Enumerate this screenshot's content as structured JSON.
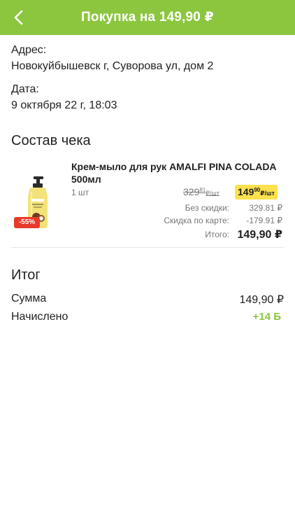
{
  "header": {
    "title": "Покупка на 149,90 ₽",
    "back_icon": "back-arrow-icon",
    "color": "#8cc63f"
  },
  "receipt": {
    "address_label": "Адрес:",
    "address_value": "Новокуйбышевск г, Суворова ул, дом 2",
    "date_label": "Дата:",
    "date_value": "9 октября 22 г, 18:03"
  },
  "composition": {
    "title": "Состав чека",
    "items": [
      {
        "name": "Крем-мыло для рук AMALFI PINA COLADA 500мл",
        "qty": "1 шт",
        "discount_badge": "-55%",
        "old_price_main": "329",
        "old_price_cents": "81",
        "old_price_unit": "₽/шт",
        "new_price_main": "149",
        "new_price_cents": "90",
        "new_price_unit": "₽/шт",
        "no_discount_label": "Без скидки:",
        "no_discount_value": "329.81 ₽",
        "card_discount_label": "Скидка по карте:",
        "card_discount_value": "-179.91 ₽",
        "total_label": "Итого:",
        "total_value": "149,90 ₽",
        "image_icon": "soap-bottle-icon"
      }
    ]
  },
  "summary": {
    "title": "Итог",
    "sum_label": "Сумма",
    "sum_value": "149,90 ₽",
    "accrued_label": "Начислено",
    "accrued_value": "+14 Б"
  }
}
